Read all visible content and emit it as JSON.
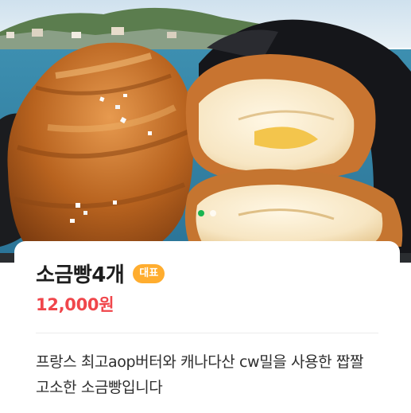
{
  "product": {
    "name": "소금빵4개",
    "badge": "대표",
    "price": "12,000원",
    "description": "프랑스 최고aop버터와 캐나다산 cw밀을 사용한 짭짤 고소한 소금빵입니다"
  },
  "carousel": {
    "total": 2,
    "active_index": 0
  },
  "colors": {
    "price": "#f0464b",
    "badge": "#ffad2f",
    "indicator_active": "#19b44f"
  }
}
